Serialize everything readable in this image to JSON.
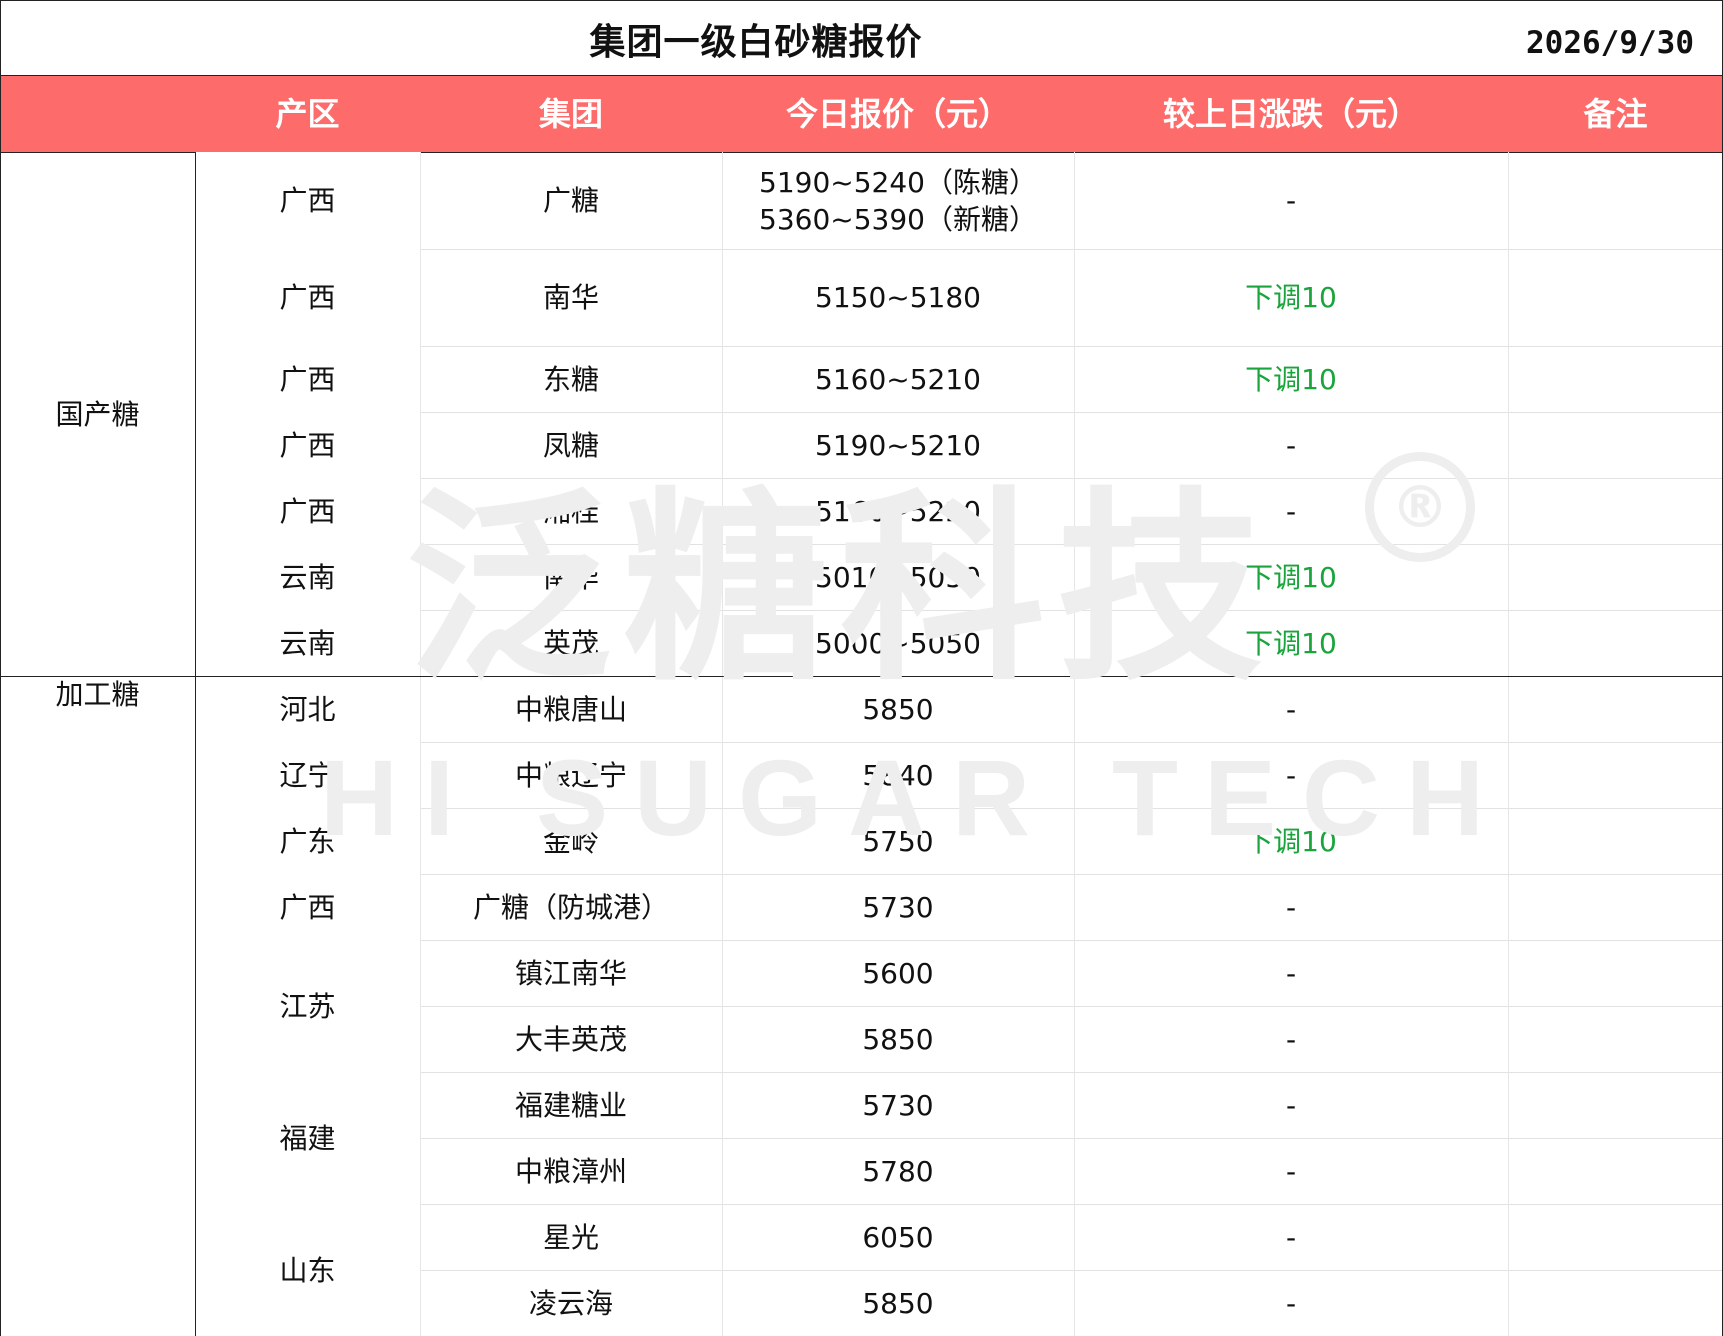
{
  "title": "集团一级白砂糖报价",
  "date": "2026/9/30",
  "headers": [
    "产区",
    "集团",
    "今日报价（元）",
    "较上日涨跌（元）",
    "备注"
  ],
  "watermark": {
    "cn": "泛糖科技",
    "en": "HI SUGAR TECH",
    "mark": "®"
  },
  "categories": [
    {
      "name": "国产糖",
      "rows": [
        0,
        6
      ]
    },
    {
      "name": "加工糖",
      "rows": [
        7,
        17
      ]
    }
  ],
  "rows": [
    {
      "region": "广西",
      "group": "广糖",
      "price": [
        "5190~5240（陈糖）",
        "5360~5390（新糖）"
      ],
      "change": "-",
      "remark": ""
    },
    {
      "region": "广西",
      "group": "南华",
      "price": [
        "5150~5180"
      ],
      "change": "下调10",
      "remark": ""
    },
    {
      "region": "广西",
      "group": "东糖",
      "price": [
        "5160~5210"
      ],
      "change": "下调10",
      "remark": ""
    },
    {
      "region": "广西",
      "group": "凤糖",
      "price": [
        "5190~5210"
      ],
      "change": "-",
      "remark": ""
    },
    {
      "region": "广西",
      "group": "湘桂",
      "price": [
        "5160~5220"
      ],
      "change": "-",
      "remark": ""
    },
    {
      "region": "云南",
      "group": "南华",
      "price": [
        "5010~5050"
      ],
      "change": "下调10",
      "remark": ""
    },
    {
      "region": "云南",
      "group": "英茂",
      "price": [
        "5000~5050"
      ],
      "change": "下调10",
      "remark": ""
    },
    {
      "region": "河北",
      "group": "中粮唐山",
      "price": [
        "5850"
      ],
      "change": "-",
      "remark": ""
    },
    {
      "region": "辽宁",
      "group": "中粮辽宁",
      "price": [
        "5840"
      ],
      "change": "-",
      "remark": ""
    },
    {
      "region": "广东",
      "group": "金岭",
      "price": [
        "5750"
      ],
      "change": "下调10",
      "remark": ""
    },
    {
      "region": "广西",
      "group": "广糖（防城港）",
      "price": [
        "5730"
      ],
      "change": "-",
      "remark": ""
    },
    {
      "region": "江苏",
      "group": "镇江南华",
      "price": [
        "5600"
      ],
      "change": "-",
      "remark": ""
    },
    {
      "region": "",
      "group": "大丰英茂",
      "price": [
        "5850"
      ],
      "change": "-",
      "remark": ""
    },
    {
      "region": "福建",
      "group": "福建糖业",
      "price": [
        "5730"
      ],
      "change": "-",
      "remark": ""
    },
    {
      "region": "",
      "group": "中粮漳州",
      "price": [
        "5780"
      ],
      "change": "-",
      "remark": ""
    },
    {
      "region": "山东",
      "group": "星光",
      "price": [
        "6050"
      ],
      "change": "-",
      "remark": ""
    },
    {
      "region": "",
      "group": "凌云海",
      "price": [
        "5850"
      ],
      "change": "-",
      "remark": ""
    }
  ],
  "region_spans": [
    {
      "rows": [
        0,
        0
      ]
    },
    {
      "rows": [
        1,
        1
      ]
    },
    {
      "rows": [
        2,
        2
      ]
    },
    {
      "rows": [
        3,
        3
      ]
    },
    {
      "rows": [
        4,
        4
      ]
    },
    {
      "rows": [
        5,
        5
      ]
    },
    {
      "rows": [
        6,
        6
      ]
    },
    {
      "rows": [
        7,
        7
      ]
    },
    {
      "rows": [
        8,
        8
      ]
    },
    {
      "rows": [
        9,
        9
      ]
    },
    {
      "rows": [
        10,
        10
      ]
    },
    {
      "rows": [
        11,
        12
      ]
    },
    {
      "rows": [
        13,
        14
      ]
    },
    {
      "rows": [
        15,
        16
      ]
    }
  ],
  "colors": {
    "header_bg": "#fd6b6b",
    "header_text": "#ffffff",
    "down": "#19a53b",
    "text": "#111111",
    "watermark": "#eeeeee"
  }
}
